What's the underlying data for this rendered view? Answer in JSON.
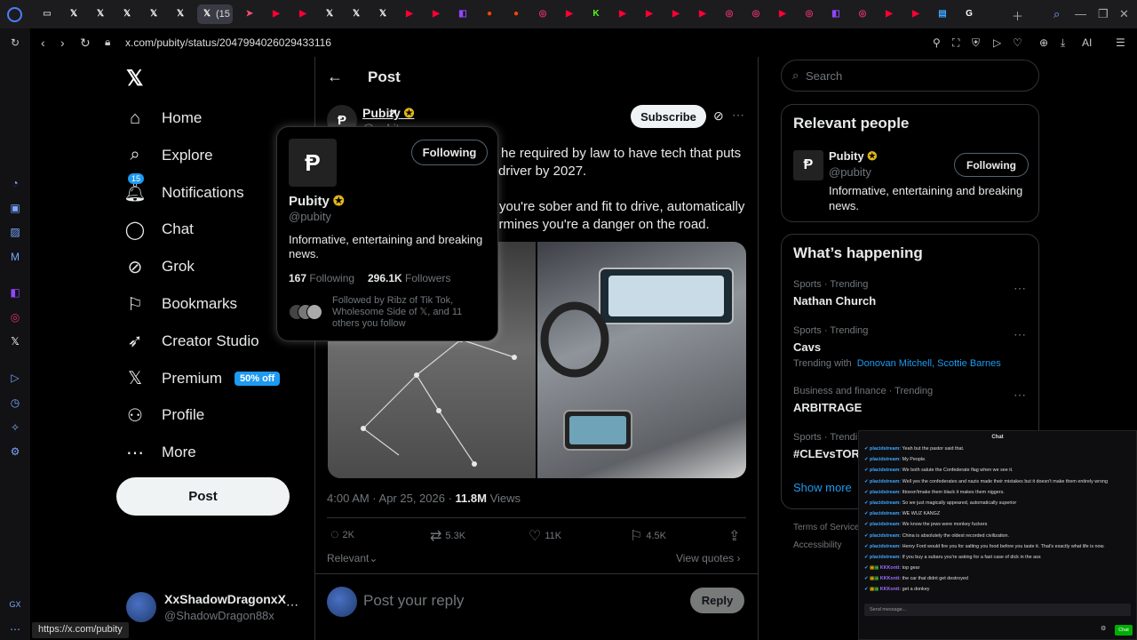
{
  "browser": {
    "url": "x.com/pubity/status/2047994026029433116",
    "status_url": "https://x.com/pubity",
    "active_tab_label": "(15",
    "ai_label": "AI",
    "tabs": [
      {
        "icon": "inbox-icon",
        "color": "#bbbbbb",
        "glyph": "▭"
      },
      {
        "icon": "x-icon",
        "color": "#ffffff",
        "glyph": "𝕏"
      },
      {
        "icon": "x-icon",
        "color": "#ffffff",
        "glyph": "𝕏"
      },
      {
        "icon": "x-icon",
        "color": "#ffffff",
        "glyph": "𝕏"
      },
      {
        "icon": "x-icon",
        "color": "#ffffff",
        "glyph": "𝕏"
      },
      {
        "icon": "x-icon",
        "color": "#ffffff",
        "glyph": "𝕏"
      },
      {
        "icon": "x-icon",
        "color": "#ffffff",
        "glyph": "𝕏"
      },
      {
        "icon": "arrow-icon",
        "color": "#ff4d6d",
        "glyph": "➤"
      },
      {
        "icon": "youtube-icon",
        "color": "#ff0033",
        "glyph": "▶"
      },
      {
        "icon": "youtube-icon",
        "color": "#ff0033",
        "glyph": "▶"
      },
      {
        "icon": "x-icon",
        "color": "#ffffff",
        "glyph": "𝕏"
      },
      {
        "icon": "x-icon",
        "color": "#ffffff",
        "glyph": "𝕏"
      },
      {
        "icon": "x-icon",
        "color": "#ffffff",
        "glyph": "𝕏"
      },
      {
        "icon": "play-icon",
        "color": "#ff0033",
        "glyph": "▶"
      },
      {
        "icon": "play-icon",
        "color": "#ff0033",
        "glyph": "▶"
      },
      {
        "icon": "twitch-icon",
        "color": "#9146ff",
        "glyph": "◧"
      },
      {
        "icon": "reddit-icon",
        "color": "#ff4500",
        "glyph": "●"
      },
      {
        "icon": "reddit-icon",
        "color": "#ff4500",
        "glyph": "●"
      },
      {
        "icon": "instagram-icon",
        "color": "#e1306c",
        "glyph": "◎"
      },
      {
        "icon": "youtube-icon",
        "color": "#ff0033",
        "glyph": "▶"
      },
      {
        "icon": "kick-icon",
        "color": "#53fc18",
        "glyph": "K"
      },
      {
        "icon": "youtube-icon",
        "color": "#ff0033",
        "glyph": "▶"
      },
      {
        "icon": "youtube-icon",
        "color": "#ff0033",
        "glyph": "▶"
      },
      {
        "icon": "youtube-icon",
        "color": "#ff0033",
        "glyph": "▶"
      },
      {
        "icon": "youtube-icon",
        "color": "#ff0033",
        "glyph": "▶"
      },
      {
        "icon": "instagram-icon",
        "color": "#e1306c",
        "glyph": "◎"
      },
      {
        "icon": "instagram-icon",
        "color": "#e1306c",
        "glyph": "◎"
      },
      {
        "icon": "youtube-icon",
        "color": "#ff0033",
        "glyph": "▶"
      },
      {
        "icon": "instagram-icon",
        "color": "#e1306c",
        "glyph": "◎"
      },
      {
        "icon": "twitch-icon",
        "color": "#9146ff",
        "glyph": "◧"
      },
      {
        "icon": "instagram-icon",
        "color": "#e1306c",
        "glyph": "◎"
      },
      {
        "icon": "youtube-icon",
        "color": "#ff0033",
        "glyph": "▶"
      },
      {
        "icon": "youtube-icon",
        "color": "#ff0033",
        "glyph": "▶"
      },
      {
        "icon": "chart-icon",
        "color": "#3ea6ff",
        "glyph": "▤"
      },
      {
        "icon": "google-icon",
        "color": "#ffffff",
        "glyph": "G"
      }
    ]
  },
  "nav": {
    "items": [
      {
        "label": "Home",
        "icon": "home-icon"
      },
      {
        "label": "Explore",
        "icon": "search-icon"
      },
      {
        "label": "Notifications",
        "icon": "bell-icon",
        "badge": "15"
      },
      {
        "label": "Chat",
        "icon": "chat-icon"
      },
      {
        "label": "Grok",
        "icon": "grok-icon"
      },
      {
        "label": "Bookmarks",
        "icon": "bookmark-icon"
      },
      {
        "label": "Creator Studio",
        "icon": "rocket-icon"
      },
      {
        "label": "Premium",
        "icon": "x-icon",
        "badge": "50% off"
      },
      {
        "label": "Profile",
        "icon": "profile-icon"
      },
      {
        "label": "More",
        "icon": "more-icon"
      }
    ],
    "post_label": "Post",
    "account": {
      "name": "XxShadowDragonxX",
      "handle": "@ShadowDragon88x"
    }
  },
  "post": {
    "header_title": "Post",
    "author_name": "Pubity",
    "author_handle": "@pubity",
    "subscribe_label": "Subscribe",
    "text_line1": "he required by law to have tech that puts",
    "text_line2": "driver by 2027.",
    "text_line3": "you're sober and fit to drive, automatically",
    "text_line4": "termines you're a danger on the road.",
    "timestamp": "4:00 AM · Apr 25, 2026 · ",
    "views_count": "11.8M",
    "views_label": "Views",
    "replies": "2K",
    "reposts": "5.3K",
    "likes": "11K",
    "bookmarks": "4.5K",
    "sort_label": "Relevant",
    "view_quotes": "View quotes",
    "reply_placeholder": "Post your reply",
    "reply_button": "Reply"
  },
  "hovercard": {
    "following_btn": "Following",
    "name": "Pubity",
    "handle": "@pubity",
    "bio": "Informative, entertaining and breaking news.",
    "following_count": "167",
    "following_label": "Following",
    "followers_count": "296.1K",
    "followers_label": "Followers",
    "followed_by": "Followed by Ribz of Tik Tok, Wholesome Side of 𝕏, and 11 others you follow"
  },
  "right": {
    "search_placeholder": "Search",
    "relevant_title": "Relevant people",
    "person_name": "Pubity",
    "person_handle": "@pubity",
    "person_following": "Following",
    "person_bio": "Informative, entertaining and breaking news.",
    "happening_title": "What’s happening",
    "trends": [
      {
        "meta": "Sports · Trending",
        "name": "Nathan Church"
      },
      {
        "meta": "Sports · Trending",
        "name": "Cavs",
        "with_label": "Trending with",
        "with_names": "Donovan Mitchell, Scottie Barnes"
      },
      {
        "meta": "Business and finance · Trending",
        "name": "ARBITRAGE"
      },
      {
        "meta": "Sports · Trendi",
        "name": "#CLEvsTOR"
      }
    ],
    "show_more": "Show more",
    "footer1": "Terms of Service",
    "footer2": "Accessibility"
  },
  "chat": {
    "title": "Chat",
    "input_placeholder": "Send message...",
    "send_label": "Chat",
    "messages": [
      {
        "user": "placidstream:",
        "text": "Yeah but the pastor said that."
      },
      {
        "user": "placidstream:",
        "text": "My People."
      },
      {
        "user": "placidstream:",
        "text": "We both salute the Confederate flag when we see it."
      },
      {
        "user": "placidstream:",
        "text": "Well yes the confederates and nazis made their mistakes but it doesn't make them entirely wrong"
      },
      {
        "user": "placidstream:",
        "text": "Ittoesn'tmake them black it makes them niggers."
      },
      {
        "user": "placidstream:",
        "text": "So we just magically appeared, automatically superior"
      },
      {
        "user": "placidstream:",
        "text": "WE WUZ KANGZ"
      },
      {
        "user": "placidstream:",
        "text": "We know the jews were monkey fuckers"
      },
      {
        "user": "placidstream:",
        "text": "China is absolutely the oldest recorded civilization."
      },
      {
        "user": "placidstream:",
        "text": "Henry Ford would fire you for salting you food before you taste it. That's exactly what life is now."
      },
      {
        "user": "placidstream:",
        "text": "If you buy a subaru you're asking for a fast case of dick in the ass"
      },
      {
        "user": "KKKonti:",
        "text": "top gear"
      },
      {
        "user": "KKKonti:",
        "text": "the car that didnt get destroyed"
      },
      {
        "user": "KKKonti:",
        "text": "get a donkey"
      }
    ]
  }
}
